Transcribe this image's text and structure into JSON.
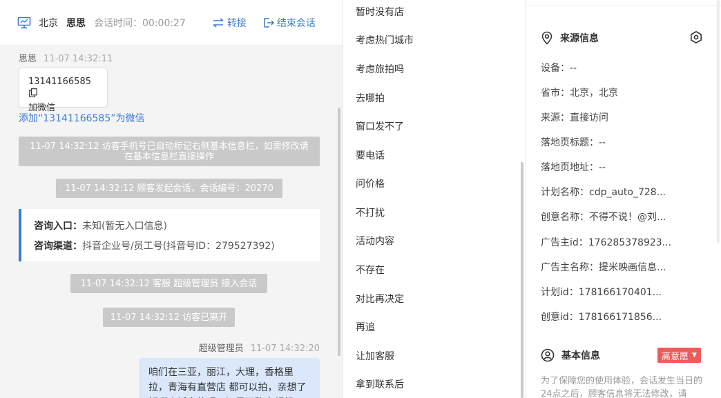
{
  "chat": {
    "header": {
      "city": "北京",
      "user_name": "思思",
      "session_time": "会话时间：00:00:27",
      "transfer_label": "转接",
      "end_label": "结束会话"
    },
    "messages": {
      "customer_name": "思思",
      "customer_time": "11-07 14:32:11",
      "phone_number": "13141166585",
      "card_action": "加微信",
      "add_wechat_link": "添加“13141166585”为微信",
      "system_1": "11-07 14:32:12 访客手机号已自动标记右侧基本信息栏，如需修改请在基本信息栏直接操作",
      "system_2": "11-07 14:32:12 顾客发起会话，会话编号：20270",
      "consult_entry_label": "咨询入口：",
      "consult_entry_value": "未知(暂无入口信息)",
      "consult_channel_label": "咨询渠道：",
      "consult_channel_value": "抖音企业号/员工号(抖音号ID：279527392)",
      "system_3": "11-07 14:32:12 客服 超级管理员 接入会话",
      "system_4": "11-07 14:32:12 访客已离开",
      "agent_name": "超级管理员",
      "agent_time": "11-07 14:32:20",
      "agent_message": "咱们在三亚，丽江，大理，香格里拉，青海有直营店 都可以拍，亲想了解哪个城市的呢？还是不确定都想了解呢"
    }
  },
  "quick_replies": [
    "暂时没有店",
    "考虑热门城市",
    "考虑旅拍吗",
    "去哪拍",
    "窗口发不了",
    "要电话",
    "问价格",
    "不打扰",
    "活动内容",
    "不存在",
    "对比再决定",
    "再追",
    "让加客服",
    "拿到联系后"
  ],
  "source_info": {
    "title": "来源信息",
    "rows": [
      "设备：--",
      "省市：北京，北京",
      "来源：直接访问",
      "落地页标题：--",
      "落地页地址：--",
      "计划名称：cdp_auto_728...",
      "创意名称：不得不说！@刘...",
      "广告主id：176285378923...",
      "广告主名称：提米映画信息...",
      "计划id：178166170401...",
      "创意id：178166171856..."
    ]
  },
  "basic_info": {
    "title": "基本信息",
    "intent_badge": "高意愿",
    "note": "为了保障您的使用体验，会话发生当日的24点之后，顾客信息将无法修改，请"
  },
  "colors": {
    "accent": "#3a7bd5",
    "badge": "#f05a5a",
    "system_bg": "#c9c9c9",
    "agent_bubble": "#dbe8fb"
  }
}
